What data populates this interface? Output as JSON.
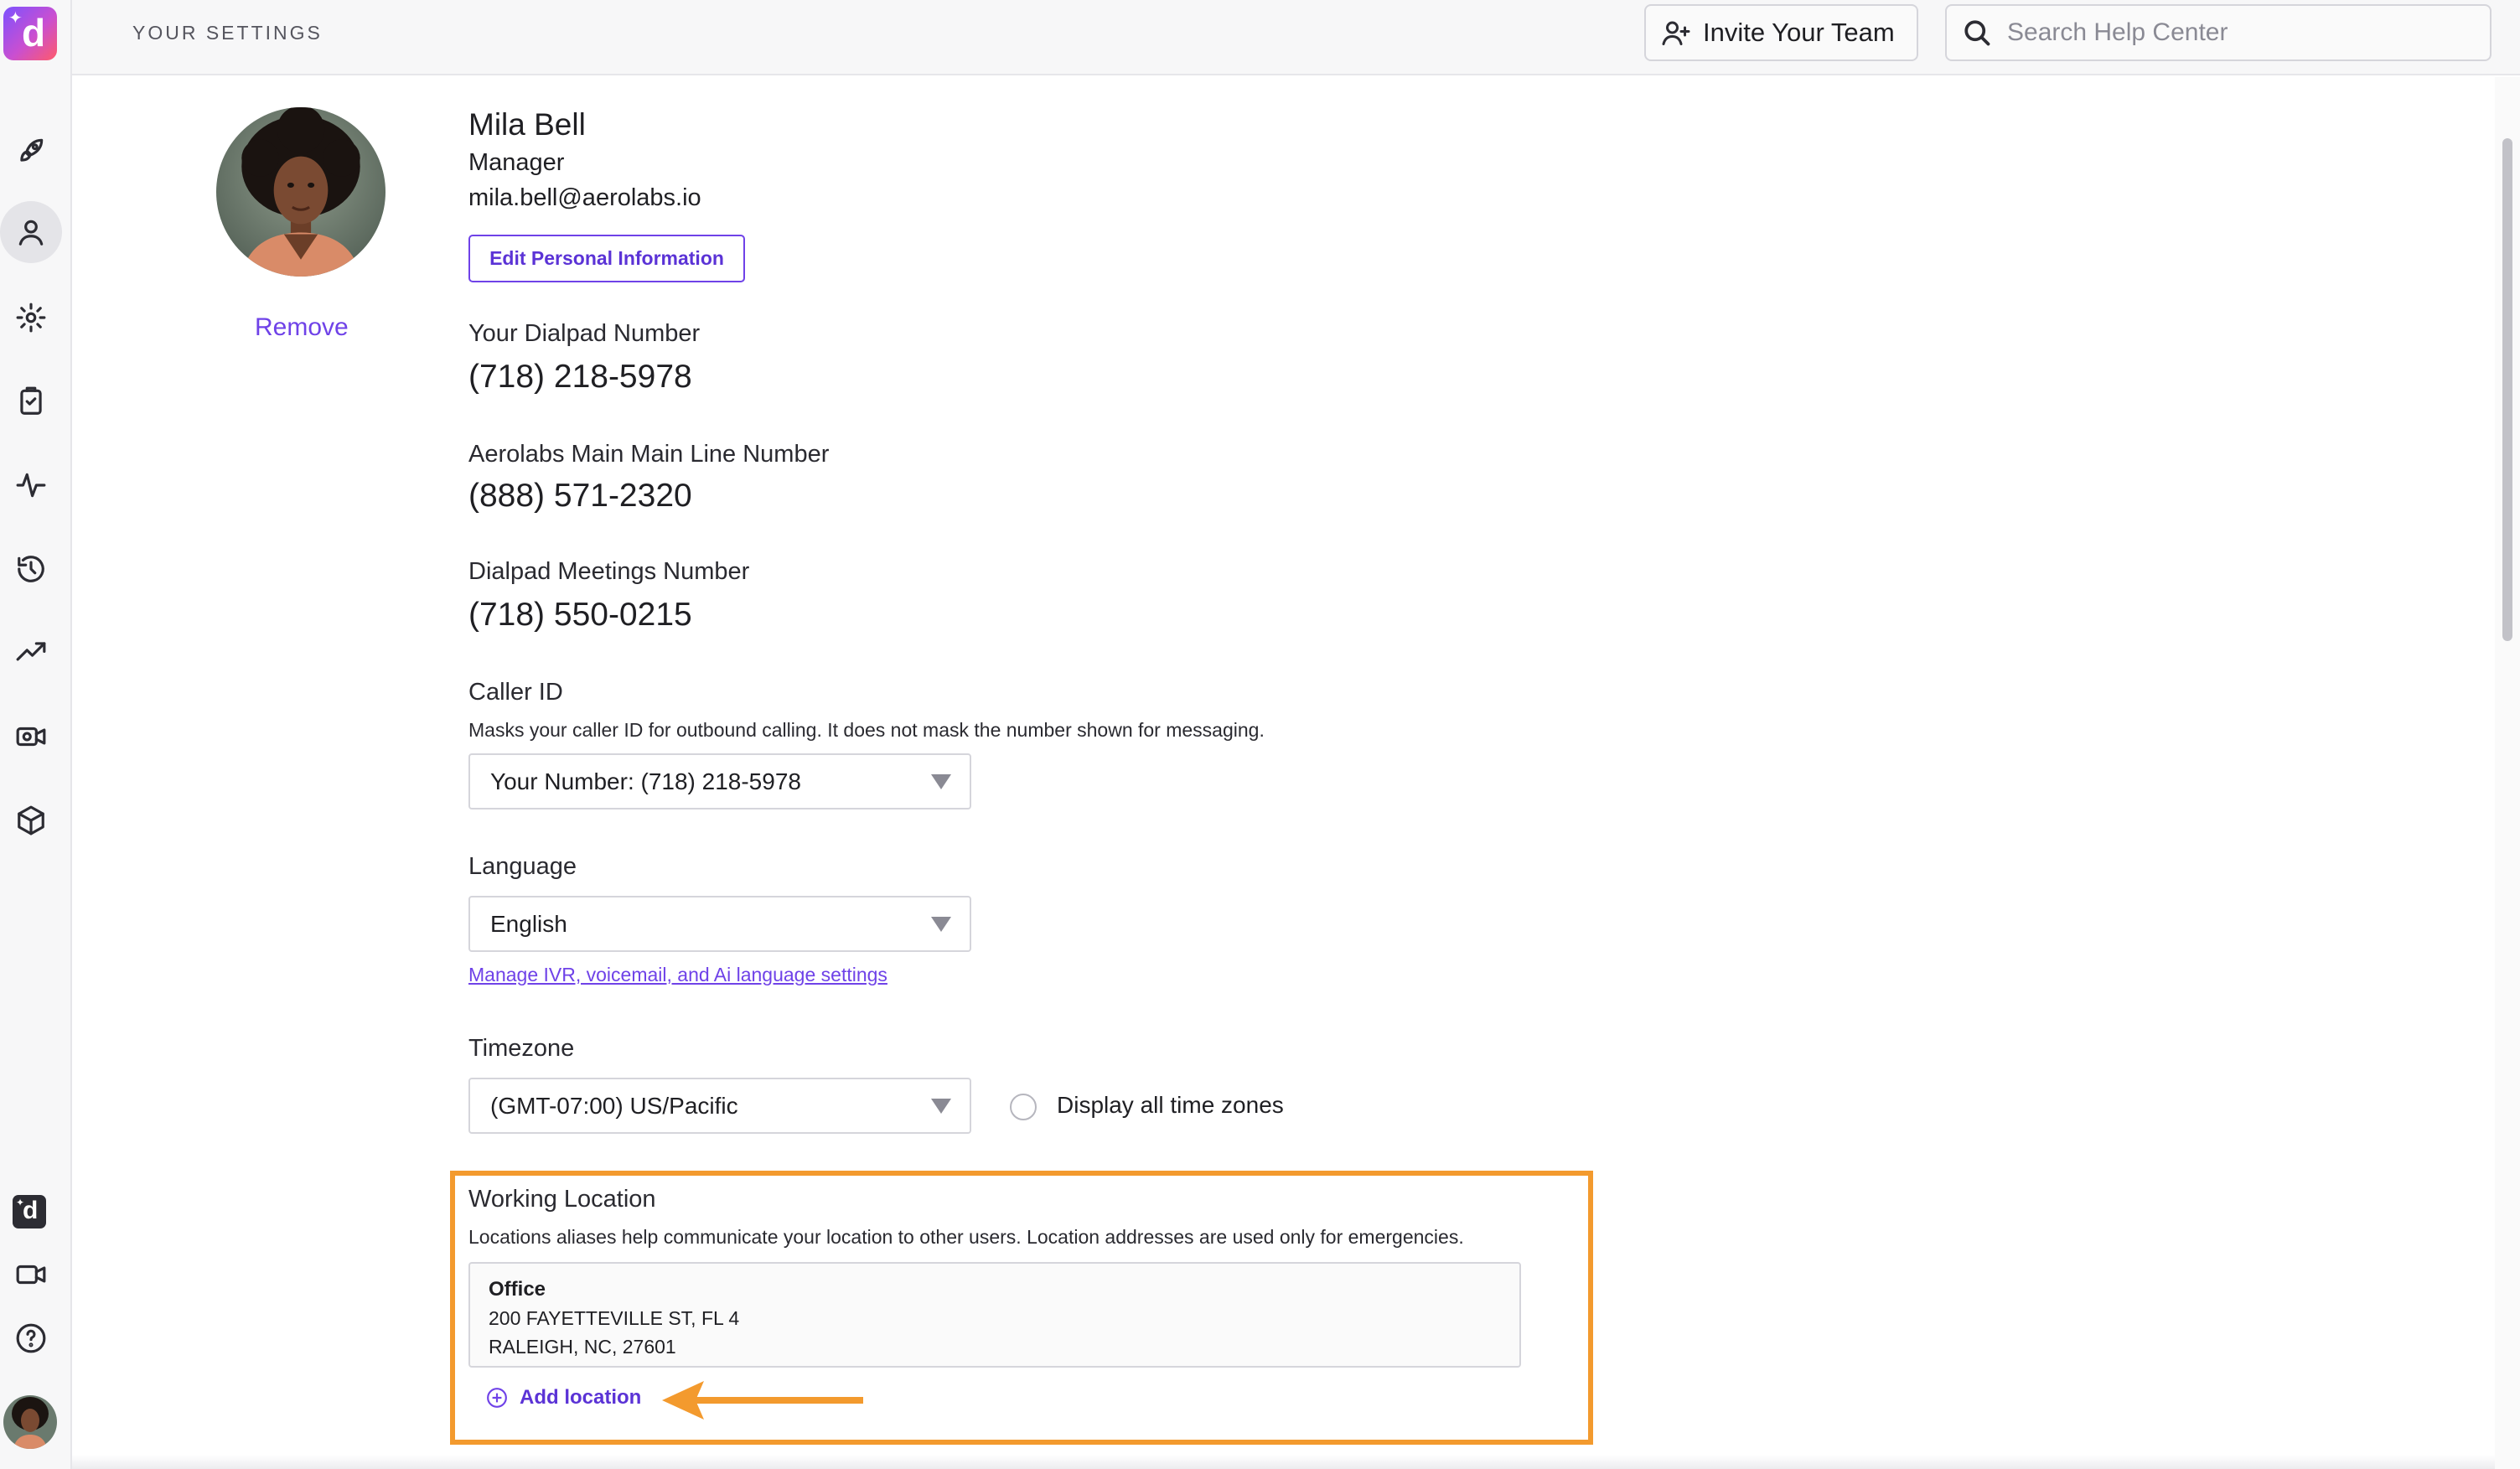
{
  "header": {
    "title": "YOUR SETTINGS",
    "invite_label": "Invite Your Team",
    "search_placeholder": "Search Help Center"
  },
  "rail": {
    "logo_letter": "d",
    "items": [
      "launch-icon",
      "profile-icon",
      "settings-icon",
      "tasks-icon",
      "activity-icon",
      "history-icon",
      "trending-icon",
      "video-settings-icon",
      "package-icon"
    ],
    "bottom_items": [
      "dialpad-app-icon",
      "video-icon",
      "help-icon"
    ]
  },
  "profile": {
    "name": "Mila Bell",
    "role": "Manager",
    "email": "mila.bell@aerolabs.io",
    "edit_label": "Edit Personal Information",
    "remove_label": "Remove"
  },
  "numbers": {
    "dialpad_label": "Your Dialpad Number",
    "dialpad_value": "(718) 218-5978",
    "mainline_label": "Aerolabs Main Main Line Number",
    "mainline_value": "(888) 571-2320",
    "meetings_label": "Dialpad Meetings Number",
    "meetings_value": "(718) 550-0215"
  },
  "caller_id": {
    "label": "Caller ID",
    "help": "Masks your caller ID for outbound calling. It does not mask the number shown for messaging.",
    "selected": "Your Number: (718) 218-5978"
  },
  "language": {
    "label": "Language",
    "selected": "English",
    "link": "Manage IVR, voicemail, and Ai language settings"
  },
  "timezone": {
    "label": "Timezone",
    "selected": "(GMT-07:00) US/Pacific",
    "toggle_label": "Display all time zones"
  },
  "working_location": {
    "label": "Working Location",
    "help": "Locations aliases help communicate your location to other users. Location addresses are used only for emergencies.",
    "location": {
      "name": "Office",
      "line1": "200 FAYETTEVILLE ST, FL 4",
      "line2": "RALEIGH, NC, 27601"
    },
    "add_label": "Add location"
  },
  "colors": {
    "accent": "#6f42e8",
    "highlight": "#f39a2e"
  }
}
